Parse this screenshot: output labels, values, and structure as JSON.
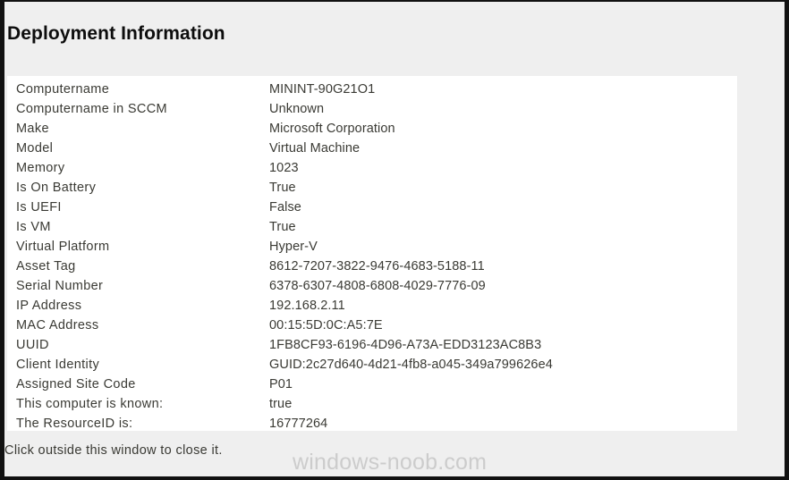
{
  "window": {
    "title": "Deployment Information",
    "footer_hint": "Click outside this window to close it.",
    "watermark": "windows-noob.com",
    "colors": {
      "window_background": "#efefef",
      "panel_background": "#ffffff",
      "border": "#111111",
      "text": "#3a3a34",
      "title_text": "#0d0d0d",
      "watermark_text": "#cccccc"
    }
  },
  "info": {
    "rows": [
      {
        "label": "Computername",
        "value": "MININT-90G21O1"
      },
      {
        "label": "Computername in SCCM",
        "value": "Unknown"
      },
      {
        "label": "Make",
        "value": "Microsoft Corporation"
      },
      {
        "label": "Model",
        "value": "Virtual Machine"
      },
      {
        "label": "Memory",
        "value": "1023"
      },
      {
        "label": "Is On Battery",
        "value": "True"
      },
      {
        "label": "Is UEFI",
        "value": "False"
      },
      {
        "label": "Is VM",
        "value": "True"
      },
      {
        "label": "Virtual Platform",
        "value": "Hyper-V"
      },
      {
        "label": "Asset Tag",
        "value": "8612-7207-3822-9476-4683-5188-11"
      },
      {
        "label": "Serial Number",
        "value": "6378-6307-4808-6808-4029-7776-09"
      },
      {
        "label": "IP Address",
        "value": "192.168.2.11"
      },
      {
        "label": "MAC Address",
        "value": "00:15:5D:0C:A5:7E"
      },
      {
        "label": "UUID",
        "value": "1FB8CF93-6196-4D96-A73A-EDD3123AC8B3"
      },
      {
        "label": "Client Identity",
        "value": "GUID:2c27d640-4d21-4fb8-a045-349a799626e4"
      },
      {
        "label": "Assigned Site Code",
        "value": "P01"
      },
      {
        "label": "This computer is known:",
        "value": "true"
      },
      {
        "label": "The ResourceID is:",
        "value": "16777264"
      }
    ]
  }
}
